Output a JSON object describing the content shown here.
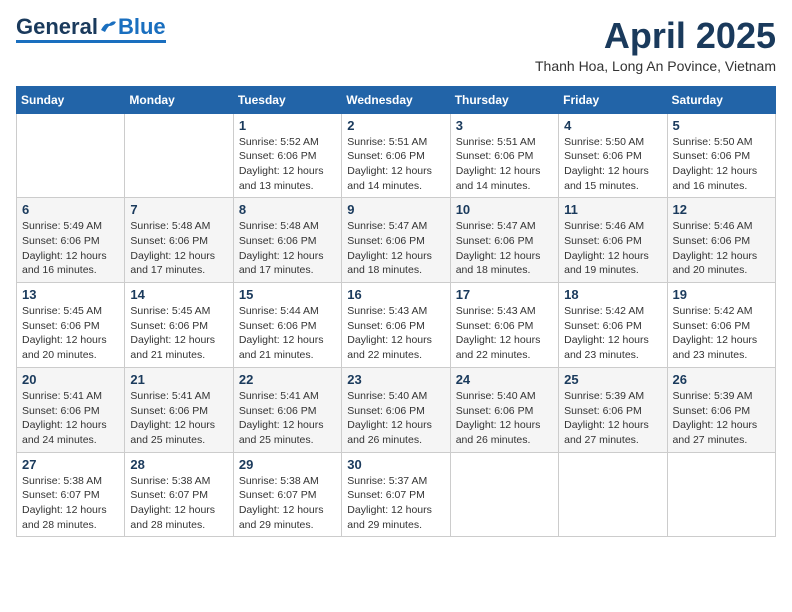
{
  "header": {
    "logo": {
      "general": "General",
      "blue": "Blue"
    },
    "title": "April 2025",
    "subtitle": "Thanh Hoa, Long An Povince, Vietnam"
  },
  "calendar": {
    "days_of_week": [
      "Sunday",
      "Monday",
      "Tuesday",
      "Wednesday",
      "Thursday",
      "Friday",
      "Saturday"
    ],
    "weeks": [
      [
        {
          "day": "",
          "sunrise": "",
          "sunset": "",
          "daylight": ""
        },
        {
          "day": "",
          "sunrise": "",
          "sunset": "",
          "daylight": ""
        },
        {
          "day": "1",
          "sunrise": "Sunrise: 5:52 AM",
          "sunset": "Sunset: 6:06 PM",
          "daylight": "Daylight: 12 hours and 13 minutes."
        },
        {
          "day": "2",
          "sunrise": "Sunrise: 5:51 AM",
          "sunset": "Sunset: 6:06 PM",
          "daylight": "Daylight: 12 hours and 14 minutes."
        },
        {
          "day": "3",
          "sunrise": "Sunrise: 5:51 AM",
          "sunset": "Sunset: 6:06 PM",
          "daylight": "Daylight: 12 hours and 14 minutes."
        },
        {
          "day": "4",
          "sunrise": "Sunrise: 5:50 AM",
          "sunset": "Sunset: 6:06 PM",
          "daylight": "Daylight: 12 hours and 15 minutes."
        },
        {
          "day": "5",
          "sunrise": "Sunrise: 5:50 AM",
          "sunset": "Sunset: 6:06 PM",
          "daylight": "Daylight: 12 hours and 16 minutes."
        }
      ],
      [
        {
          "day": "6",
          "sunrise": "Sunrise: 5:49 AM",
          "sunset": "Sunset: 6:06 PM",
          "daylight": "Daylight: 12 hours and 16 minutes."
        },
        {
          "day": "7",
          "sunrise": "Sunrise: 5:48 AM",
          "sunset": "Sunset: 6:06 PM",
          "daylight": "Daylight: 12 hours and 17 minutes."
        },
        {
          "day": "8",
          "sunrise": "Sunrise: 5:48 AM",
          "sunset": "Sunset: 6:06 PM",
          "daylight": "Daylight: 12 hours and 17 minutes."
        },
        {
          "day": "9",
          "sunrise": "Sunrise: 5:47 AM",
          "sunset": "Sunset: 6:06 PM",
          "daylight": "Daylight: 12 hours and 18 minutes."
        },
        {
          "day": "10",
          "sunrise": "Sunrise: 5:47 AM",
          "sunset": "Sunset: 6:06 PM",
          "daylight": "Daylight: 12 hours and 18 minutes."
        },
        {
          "day": "11",
          "sunrise": "Sunrise: 5:46 AM",
          "sunset": "Sunset: 6:06 PM",
          "daylight": "Daylight: 12 hours and 19 minutes."
        },
        {
          "day": "12",
          "sunrise": "Sunrise: 5:46 AM",
          "sunset": "Sunset: 6:06 PM",
          "daylight": "Daylight: 12 hours and 20 minutes."
        }
      ],
      [
        {
          "day": "13",
          "sunrise": "Sunrise: 5:45 AM",
          "sunset": "Sunset: 6:06 PM",
          "daylight": "Daylight: 12 hours and 20 minutes."
        },
        {
          "day": "14",
          "sunrise": "Sunrise: 5:45 AM",
          "sunset": "Sunset: 6:06 PM",
          "daylight": "Daylight: 12 hours and 21 minutes."
        },
        {
          "day": "15",
          "sunrise": "Sunrise: 5:44 AM",
          "sunset": "Sunset: 6:06 PM",
          "daylight": "Daylight: 12 hours and 21 minutes."
        },
        {
          "day": "16",
          "sunrise": "Sunrise: 5:43 AM",
          "sunset": "Sunset: 6:06 PM",
          "daylight": "Daylight: 12 hours and 22 minutes."
        },
        {
          "day": "17",
          "sunrise": "Sunrise: 5:43 AM",
          "sunset": "Sunset: 6:06 PM",
          "daylight": "Daylight: 12 hours and 22 minutes."
        },
        {
          "day": "18",
          "sunrise": "Sunrise: 5:42 AM",
          "sunset": "Sunset: 6:06 PM",
          "daylight": "Daylight: 12 hours and 23 minutes."
        },
        {
          "day": "19",
          "sunrise": "Sunrise: 5:42 AM",
          "sunset": "Sunset: 6:06 PM",
          "daylight": "Daylight: 12 hours and 23 minutes."
        }
      ],
      [
        {
          "day": "20",
          "sunrise": "Sunrise: 5:41 AM",
          "sunset": "Sunset: 6:06 PM",
          "daylight": "Daylight: 12 hours and 24 minutes."
        },
        {
          "day": "21",
          "sunrise": "Sunrise: 5:41 AM",
          "sunset": "Sunset: 6:06 PM",
          "daylight": "Daylight: 12 hours and 25 minutes."
        },
        {
          "day": "22",
          "sunrise": "Sunrise: 5:41 AM",
          "sunset": "Sunset: 6:06 PM",
          "daylight": "Daylight: 12 hours and 25 minutes."
        },
        {
          "day": "23",
          "sunrise": "Sunrise: 5:40 AM",
          "sunset": "Sunset: 6:06 PM",
          "daylight": "Daylight: 12 hours and 26 minutes."
        },
        {
          "day": "24",
          "sunrise": "Sunrise: 5:40 AM",
          "sunset": "Sunset: 6:06 PM",
          "daylight": "Daylight: 12 hours and 26 minutes."
        },
        {
          "day": "25",
          "sunrise": "Sunrise: 5:39 AM",
          "sunset": "Sunset: 6:06 PM",
          "daylight": "Daylight: 12 hours and 27 minutes."
        },
        {
          "day": "26",
          "sunrise": "Sunrise: 5:39 AM",
          "sunset": "Sunset: 6:06 PM",
          "daylight": "Daylight: 12 hours and 27 minutes."
        }
      ],
      [
        {
          "day": "27",
          "sunrise": "Sunrise: 5:38 AM",
          "sunset": "Sunset: 6:07 PM",
          "daylight": "Daylight: 12 hours and 28 minutes."
        },
        {
          "day": "28",
          "sunrise": "Sunrise: 5:38 AM",
          "sunset": "Sunset: 6:07 PM",
          "daylight": "Daylight: 12 hours and 28 minutes."
        },
        {
          "day": "29",
          "sunrise": "Sunrise: 5:38 AM",
          "sunset": "Sunset: 6:07 PM",
          "daylight": "Daylight: 12 hours and 29 minutes."
        },
        {
          "day": "30",
          "sunrise": "Sunrise: 5:37 AM",
          "sunset": "Sunset: 6:07 PM",
          "daylight": "Daylight: 12 hours and 29 minutes."
        },
        {
          "day": "",
          "sunrise": "",
          "sunset": "",
          "daylight": ""
        },
        {
          "day": "",
          "sunrise": "",
          "sunset": "",
          "daylight": ""
        },
        {
          "day": "",
          "sunrise": "",
          "sunset": "",
          "daylight": ""
        }
      ]
    ]
  }
}
